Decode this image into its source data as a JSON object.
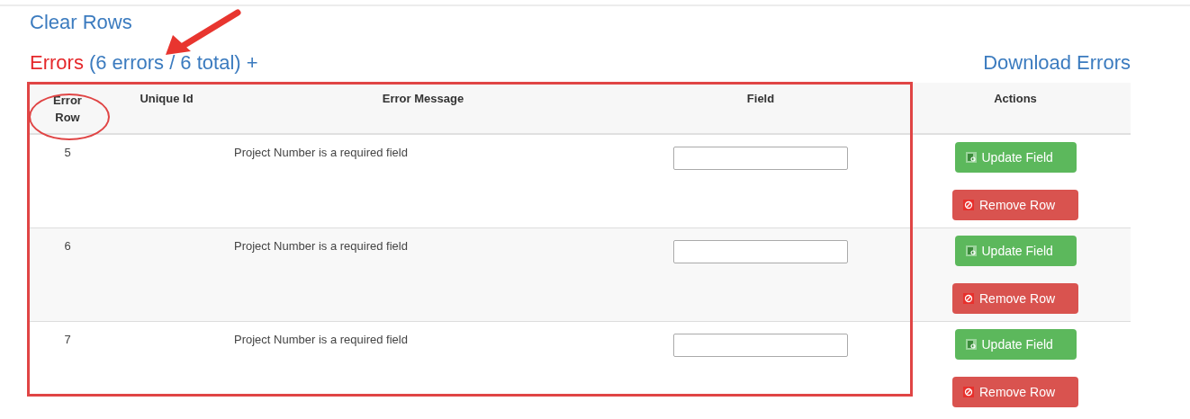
{
  "clear_rows_link": "Clear Rows",
  "errors_heading": {
    "label": "Errors",
    "summary": "(6 errors / 6 total) +"
  },
  "download_link": "Download Errors",
  "table": {
    "columns": [
      "Error Row",
      "Unique Id",
      "Error Message",
      "Field",
      "Actions"
    ],
    "rows": [
      {
        "error_row": "5",
        "message": "Project Number is a required field",
        "update_button": "Update Field",
        "remove_button": "Remove Row"
      },
      {
        "error_row": "6",
        "message": "Project Number is a required field",
        "update_button": "Update Field",
        "remove_button": "Remove Row"
      },
      {
        "error_row": "7",
        "message": "Project Number is a required field",
        "update_button": "Update Field",
        "remove_button": "Remove Row"
      }
    ]
  }
}
